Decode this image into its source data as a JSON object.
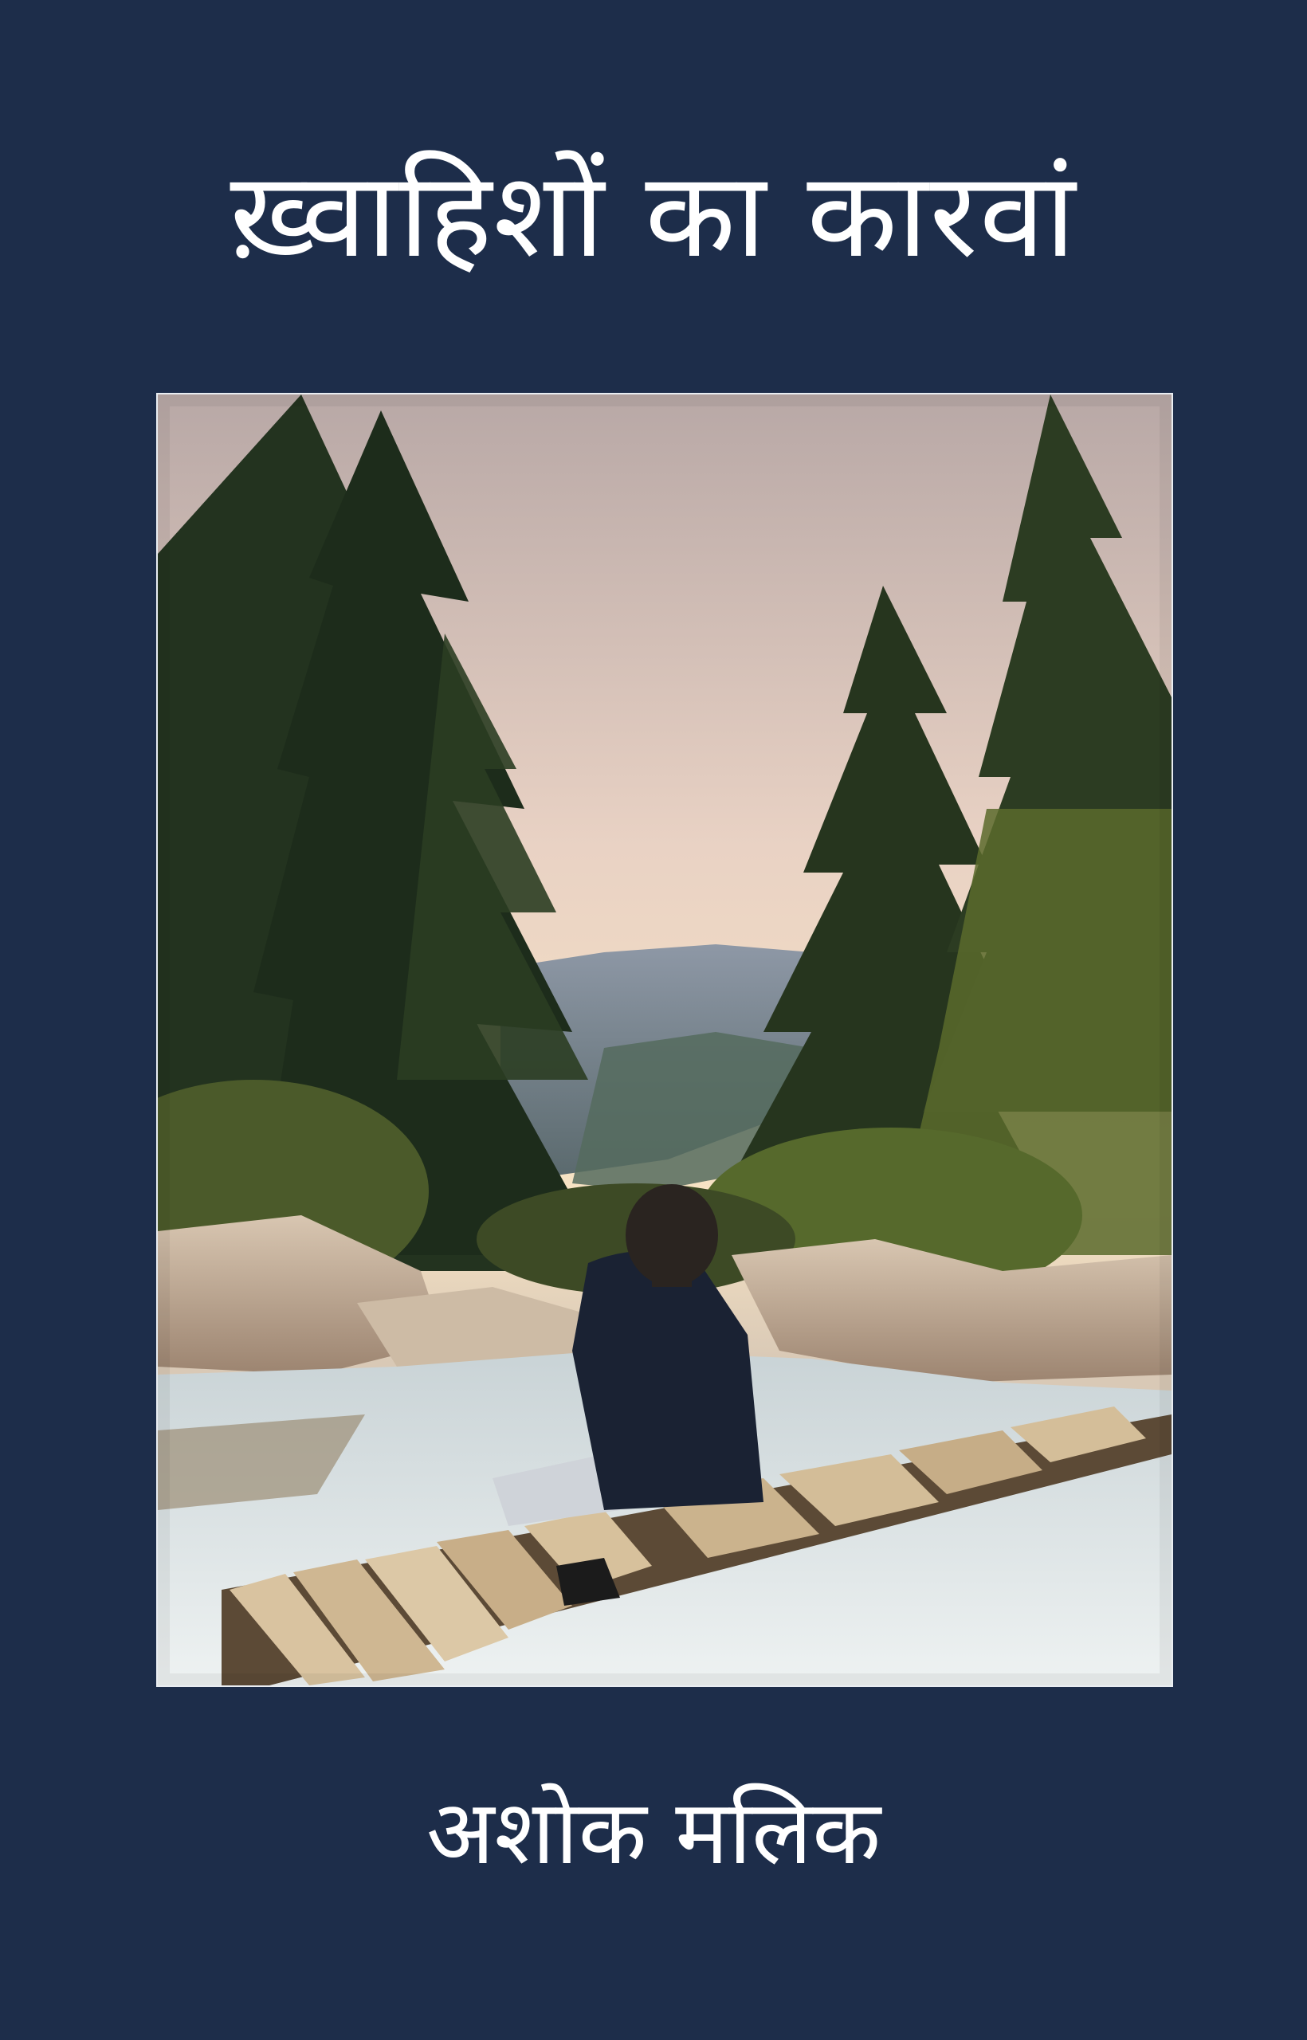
{
  "book": {
    "title": "ख़्वाहिशों का कारवां",
    "author": "अशोक मलिक"
  },
  "colors": {
    "background": "#1d2d4a",
    "text": "#ffffff",
    "photo_border": "#e9edf2"
  }
}
